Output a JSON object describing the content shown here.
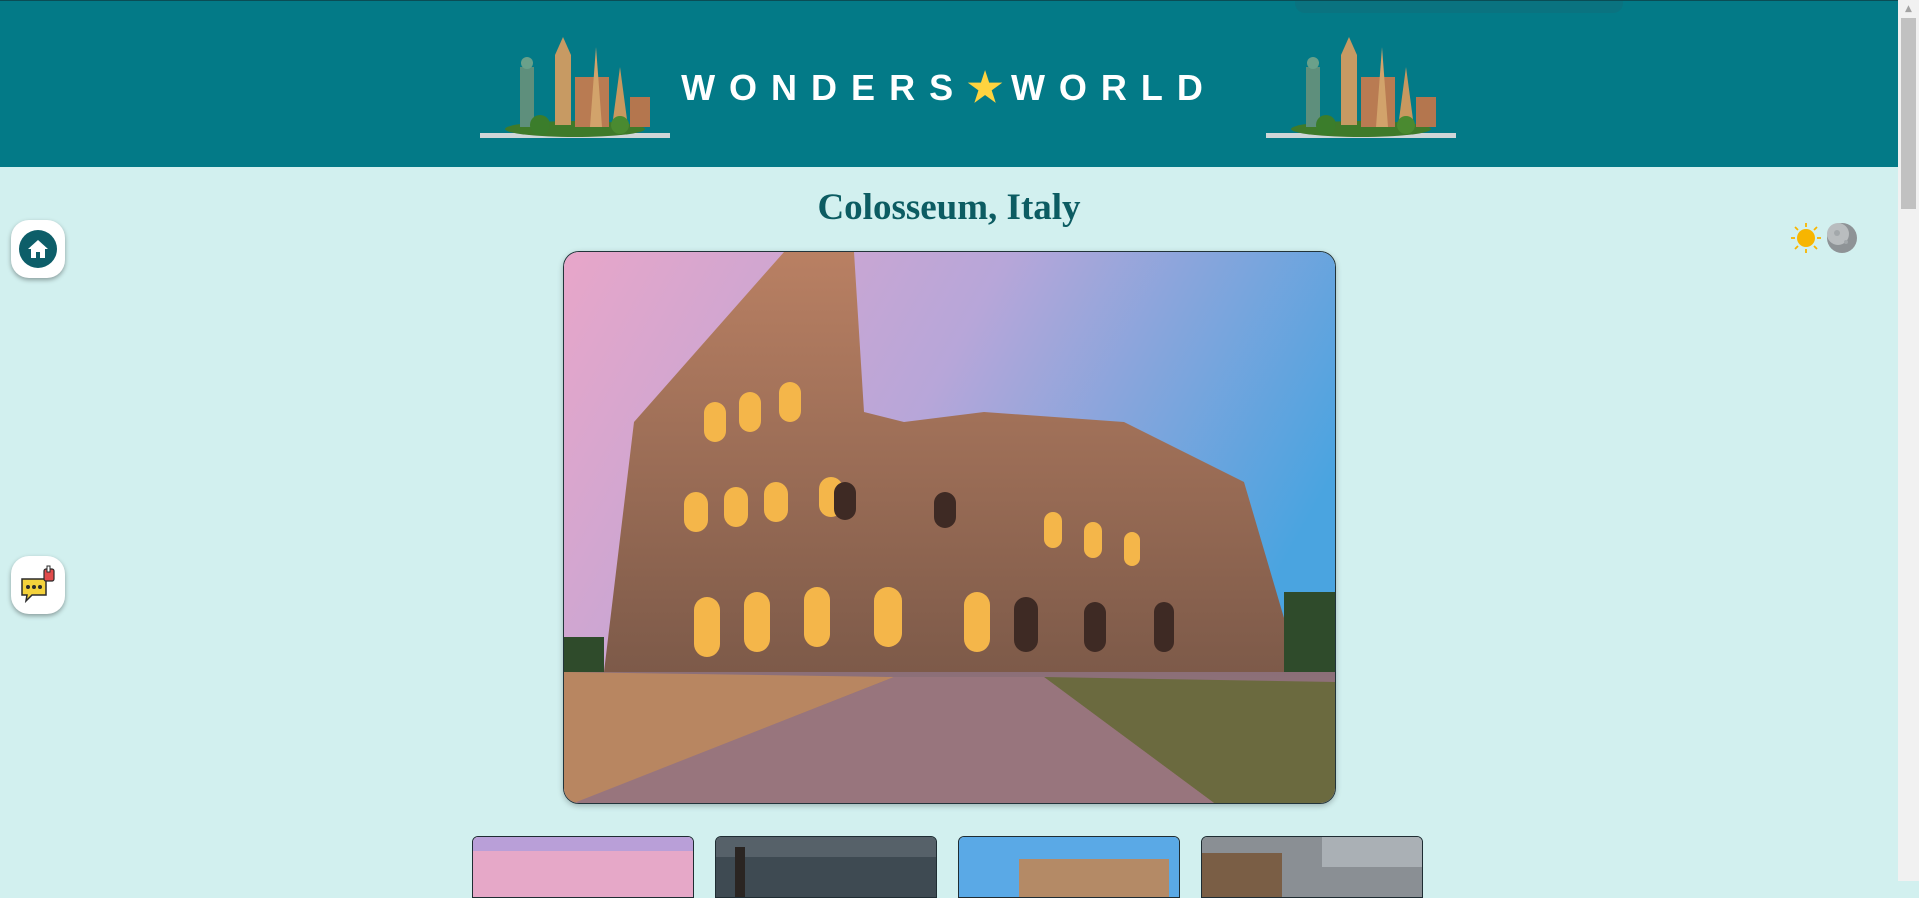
{
  "header": {
    "title_left": "WONDERS",
    "title_right": "WORLD",
    "star_glyph": "★",
    "brand_color": "#037a87",
    "star_color": "#ffd33f",
    "landmark_icon": "world-landmarks-illustration"
  },
  "page": {
    "title": "Colosseum, Italy",
    "background": "#d2f0ef",
    "title_color": "#0c5c62"
  },
  "side_buttons": {
    "home_icon": "home-icon",
    "feedback_icon": "feedback-thumbs-up-chat-icon"
  },
  "theme_toggle": {
    "light_icon": "sun-icon",
    "dark_icon": "moon-icon"
  },
  "main_photo": {
    "subject": "Colosseum at dusk"
  },
  "thumbnails": [
    {
      "icon": "colosseum-sunset-thumbnail"
    },
    {
      "icon": "stone-column-thumbnail"
    },
    {
      "icon": "colosseum-blue-sky-thumbnail"
    },
    {
      "icon": "colosseum-cloudy-thumbnail"
    }
  ]
}
